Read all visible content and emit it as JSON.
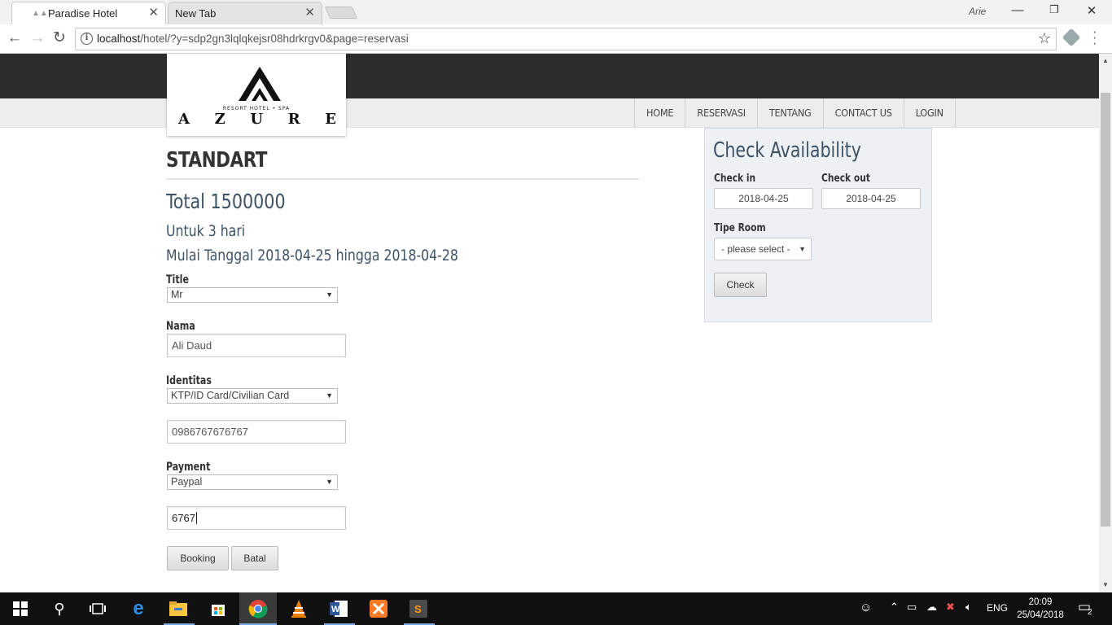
{
  "browser": {
    "tabs": [
      {
        "title": "Paradise Hotel",
        "active": true
      },
      {
        "title": "New Tab",
        "active": false
      }
    ],
    "profile_name": "Arie",
    "url_host": "localhost",
    "url_path": "/hotel/?y=sdp2gn3lqlqkejsr08hdrkrgv0&page=reservasi"
  },
  "site": {
    "logo_tagline": "RESORT HOTEL • SPA",
    "logo_letters": [
      "A",
      "Z",
      "U",
      "R",
      "E"
    ],
    "nav": [
      "HOME",
      "RESERVASI",
      "TENTANG",
      "CONTACT US",
      "LOGIN"
    ]
  },
  "reservation": {
    "room_type": "STANDART",
    "total": "Total 1500000",
    "duration": "Untuk 3 hari",
    "date_range": "Mulai Tanggal 2018-04-25 hingga 2018-04-28",
    "title_label": "Title",
    "title_value": "Mr",
    "name_label": "Nama",
    "name_value": "Ali Daud",
    "id_label": "Identitas",
    "id_type_value": "KTP/ID Card/Civilian Card",
    "id_number_value": "0986767676767",
    "payment_label": "Payment",
    "payment_value": "Paypal",
    "payment_number_value": "6767",
    "booking_button": "Booking",
    "cancel_button": "Batal"
  },
  "availability": {
    "title": "Check Availability",
    "checkin_label": "Check in",
    "checkin_value": "2018-04-25",
    "checkout_label": "Check out",
    "checkout_value": "2018-04-25",
    "room_type_label": "Tipe Room",
    "room_type_placeholder": "- please select -",
    "check_button": "Check"
  },
  "taskbar": {
    "language": "ENG",
    "time": "20:09",
    "date": "25/04/2018",
    "notification_count": "2"
  },
  "colors": {
    "heading_blue": "#3e5266",
    "header_dark": "#2c2c2c",
    "sidebar_bg": "#eef1f4"
  }
}
